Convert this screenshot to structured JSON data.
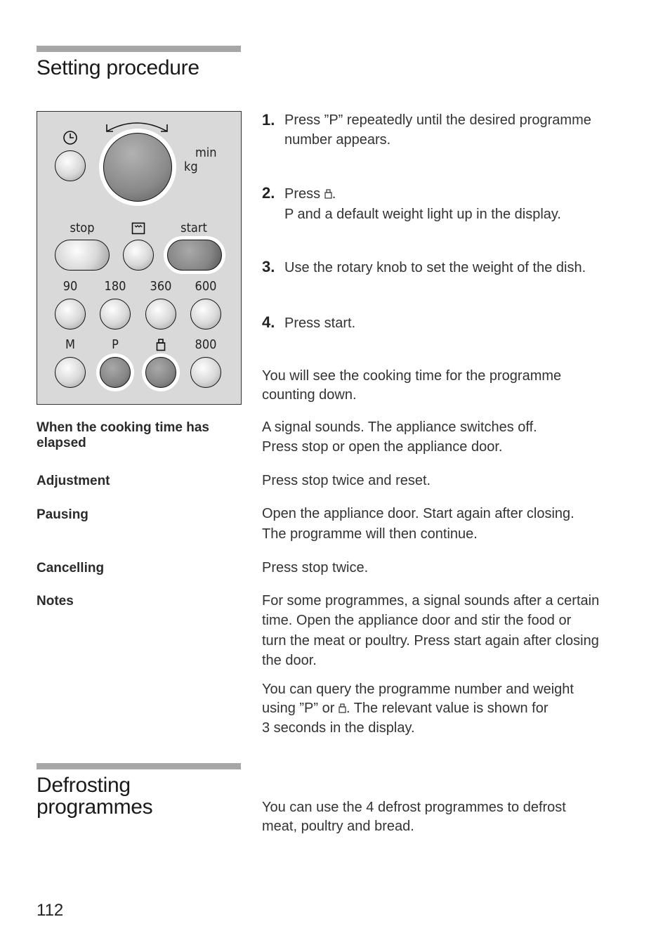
{
  "section1": {
    "title": "Setting procedure"
  },
  "panel": {
    "timer_icon": "clock-icon",
    "knob_label_line1": "min",
    "knob_label_line2": "kg",
    "stop_label": "stop",
    "oven_icon": "oven-icon",
    "start_label": "start",
    "row3_labels": [
      "90",
      "180",
      "360",
      "600"
    ],
    "row4_labels": [
      "M",
      "P",
      "weight-icon",
      "800"
    ]
  },
  "steps": [
    {
      "num": "1.",
      "line1": "Press ”P” repeatedly until the desired programme",
      "line2": "number appears."
    },
    {
      "num": "2.",
      "line1_prefix": "Press ",
      "line1_suffix": ".",
      "line2": "P and a default weight light up in the display."
    },
    {
      "num": "3.",
      "line1": "Use the rotary knob to set the weight of the dish."
    },
    {
      "num": "4.",
      "line1": "Press start."
    }
  ],
  "countdown_text": {
    "line1": "You will see the cooking time for the programme",
    "line2": "counting down."
  },
  "rows": [
    {
      "label_line1": "When the cooking time has",
      "label_line2": "elapsed",
      "text_line1": "A signal sounds. The appliance switches off.",
      "text_line2": "Press stop or open the appliance door."
    },
    {
      "label_line1": "Adjustment",
      "text_line1": "Press stop twice and reset."
    },
    {
      "label_line1": "Pausing",
      "text_line1": "Open the appliance door. Start again after closing.",
      "text_line2": "The programme will then continue."
    },
    {
      "label_line1": "Cancelling",
      "text_line1": "Press stop twice."
    },
    {
      "label_line1": "Notes",
      "text_line1": "For some programmes, a signal sounds after a certain",
      "text_line2": "time. Open the appliance door and stir the food or",
      "text_line3": "turn the meat or poultry. Press start again after closing",
      "text_line4": "the door."
    }
  ],
  "notes2": {
    "line1": "You can query the programme number and weight",
    "line2_prefix": "using ”P” or ",
    "line2_suffix": ". The relevant value is shown for",
    "line3": "3 seconds in the display."
  },
  "section2": {
    "title_line1": "Defrosting",
    "title_line2": "programmes",
    "text_line1": "You can use the 4 defrost programmes to defrost",
    "text_line2": "meat, poultry and bread."
  },
  "page_number": "112"
}
